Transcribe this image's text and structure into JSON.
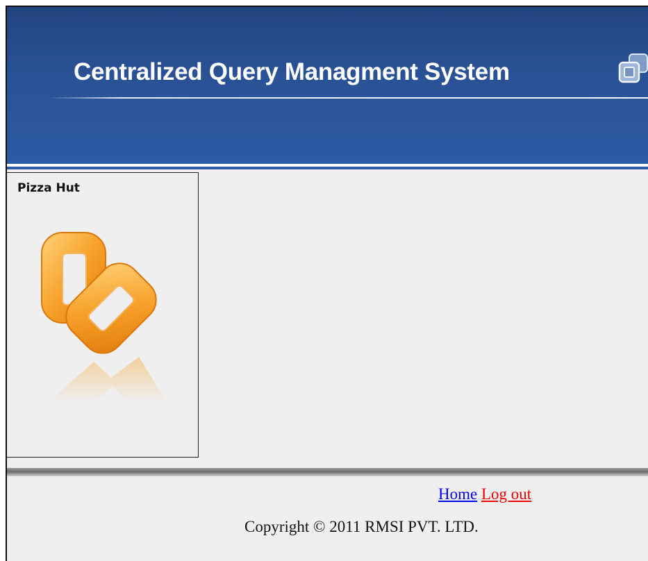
{
  "header": {
    "title": "Centralized Query Managment System",
    "icon": "window-restore-icon",
    "background_color": "#2a5296"
  },
  "sidebar": {
    "company_name": "Pizza Hut",
    "logo": "chain-link-icon",
    "logo_color": "#f39a1e"
  },
  "footer": {
    "home_label": "Home",
    "logout_label": "Log out",
    "copyright": "Copyright © 2011 RMSI PVT. LTD."
  }
}
